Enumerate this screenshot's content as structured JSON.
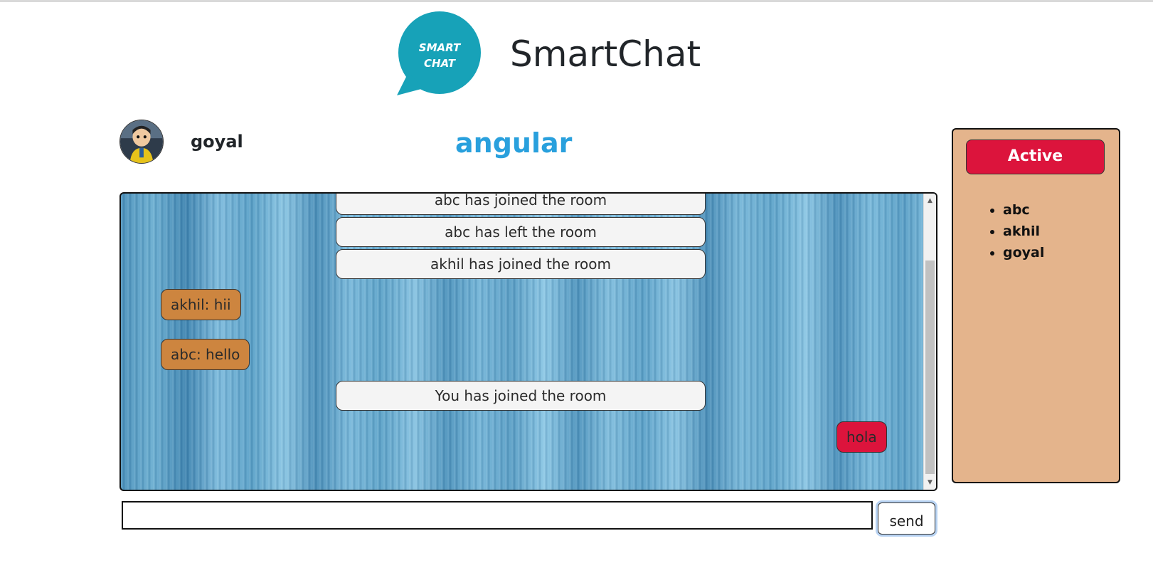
{
  "app": {
    "title": "SmartChat",
    "logo_text_line1": "SMART",
    "logo_text_line2": "CHAT",
    "logo_color": "#17a2b8"
  },
  "user": {
    "name": "goyal"
  },
  "room": {
    "name": "angular",
    "name_color": "#29a0dd"
  },
  "messages": [
    {
      "type": "system",
      "text": "abc has joined the room"
    },
    {
      "type": "system",
      "text": "abc has left the room"
    },
    {
      "type": "system",
      "text": "akhil has joined the room"
    },
    {
      "type": "incoming",
      "text": "akhil: hii"
    },
    {
      "type": "incoming",
      "text": "abc: hello"
    },
    {
      "type": "system",
      "text": "You has joined the room"
    },
    {
      "type": "outgoing",
      "text": "hola"
    }
  ],
  "composer": {
    "input_value": "",
    "send_label": "send"
  },
  "active_panel": {
    "title": "Active",
    "users": [
      "abc",
      "akhil",
      "goyal"
    ]
  },
  "colors": {
    "incoming_bubble": "#cd853f",
    "outgoing_bubble": "#dc143c",
    "active_panel_bg": "#e4b48c",
    "active_badge": "#dc143c"
  }
}
